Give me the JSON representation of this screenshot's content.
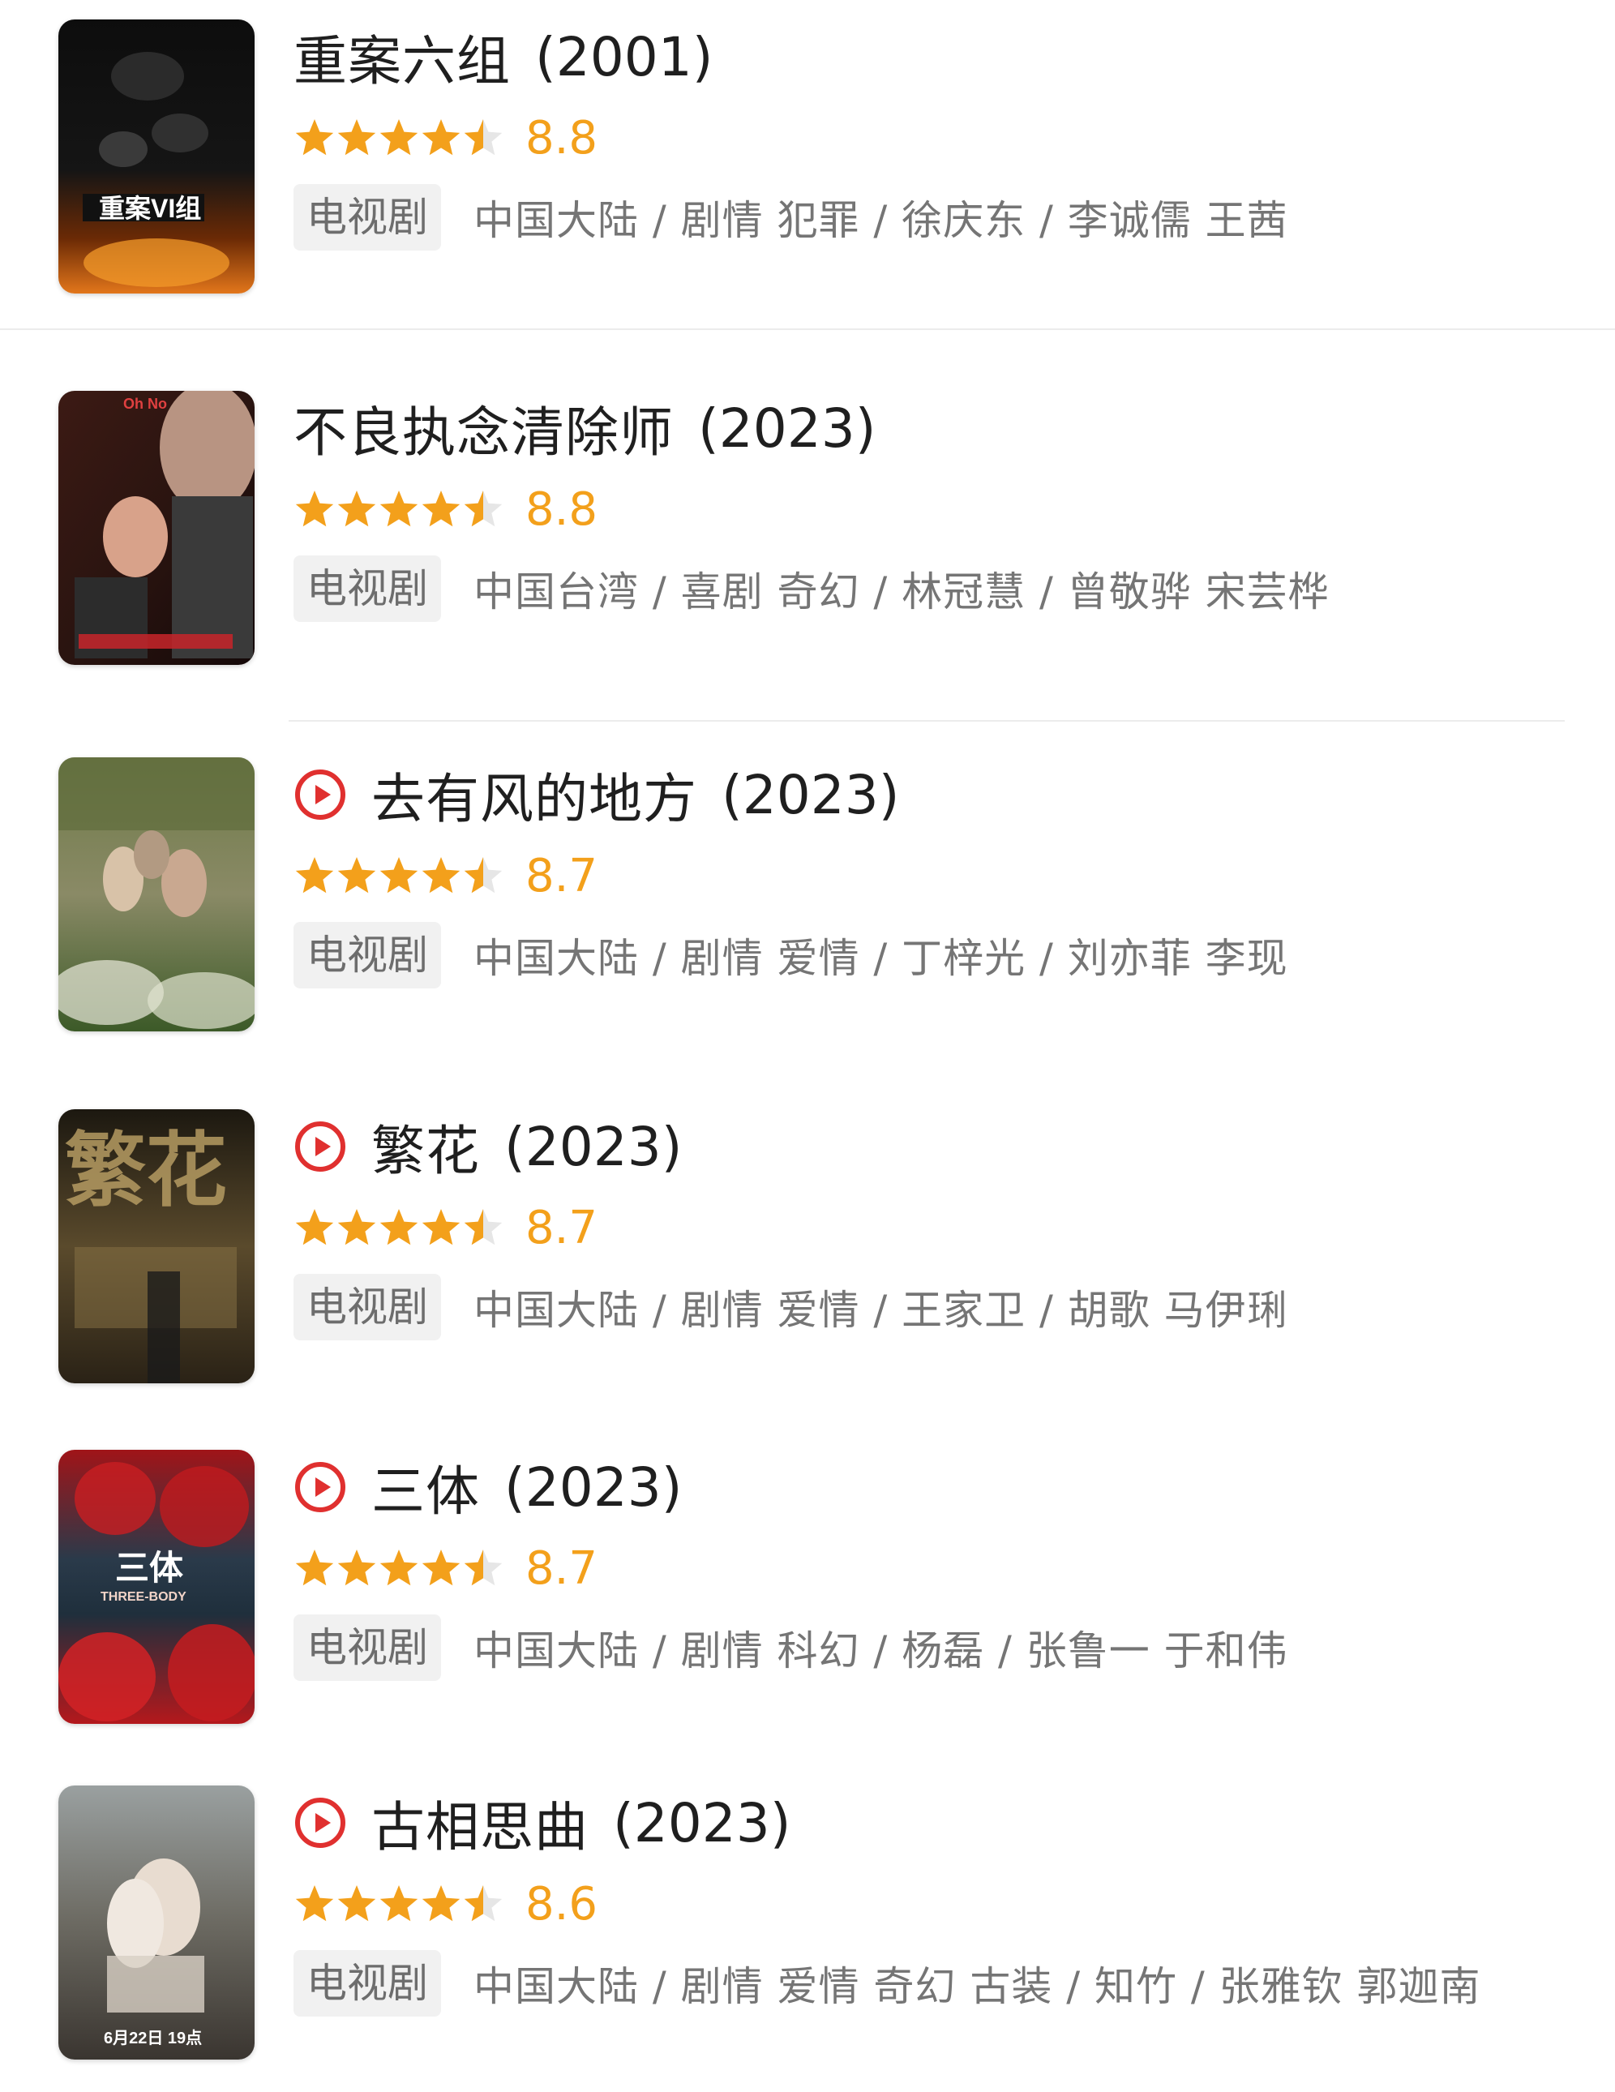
{
  "colors": {
    "star": "#f3a01b",
    "score": "#f3a01b",
    "play": "#e0302f",
    "tag_bg": "#f1f1f1"
  },
  "items": [
    {
      "title": "重案六组",
      "year": "(2001)",
      "rating": "8.8",
      "star_rating": 4.5,
      "tag": "电视剧",
      "meta": "中国大陆 / 剧情 犯罪 / 徐庆东 / 李诚儒 王茜",
      "playable": false,
      "poster_text": "重案VI组"
    },
    {
      "title": "不良执念清除师",
      "year": "(2023)",
      "rating": "8.8",
      "star_rating": 4.5,
      "tag": "电视剧",
      "meta": "中国台湾 / 喜剧 奇幻 / 林冠慧 / 曾敬骅 宋芸桦",
      "playable": false,
      "poster_text": "Oh No"
    },
    {
      "title": "去有风的地方",
      "year": "(2023)",
      "rating": "8.7",
      "star_rating": 4.5,
      "tag": "电视剧",
      "meta": "中国大陆 / 剧情 爱情 / 丁梓光 / 刘亦菲 李现",
      "playable": true,
      "poster_text": ""
    },
    {
      "title": "繁花",
      "year": "(2023)",
      "rating": "8.7",
      "star_rating": 4.5,
      "tag": "电视剧",
      "meta": "中国大陆 / 剧情 爱情 / 王家卫 / 胡歌 马伊琍",
      "playable": true,
      "poster_text": "繁花"
    },
    {
      "title": "三体",
      "year": "(2023)",
      "rating": "8.7",
      "star_rating": 4.5,
      "tag": "电视剧",
      "meta": "中国大陆 / 剧情 科幻 / 杨磊 / 张鲁一 于和伟",
      "playable": true,
      "poster_text": "三体",
      "poster_subtext": "THREE-BODY"
    },
    {
      "title": "古相思曲",
      "year": "(2023)",
      "rating": "8.6",
      "star_rating": 4.5,
      "tag": "电视剧",
      "meta": "中国大陆 / 剧情 爱情 奇幻 古装 / 知竹 / 张雅钦 郭迦南",
      "playable": true,
      "poster_text": "6月22日 19点"
    }
  ]
}
